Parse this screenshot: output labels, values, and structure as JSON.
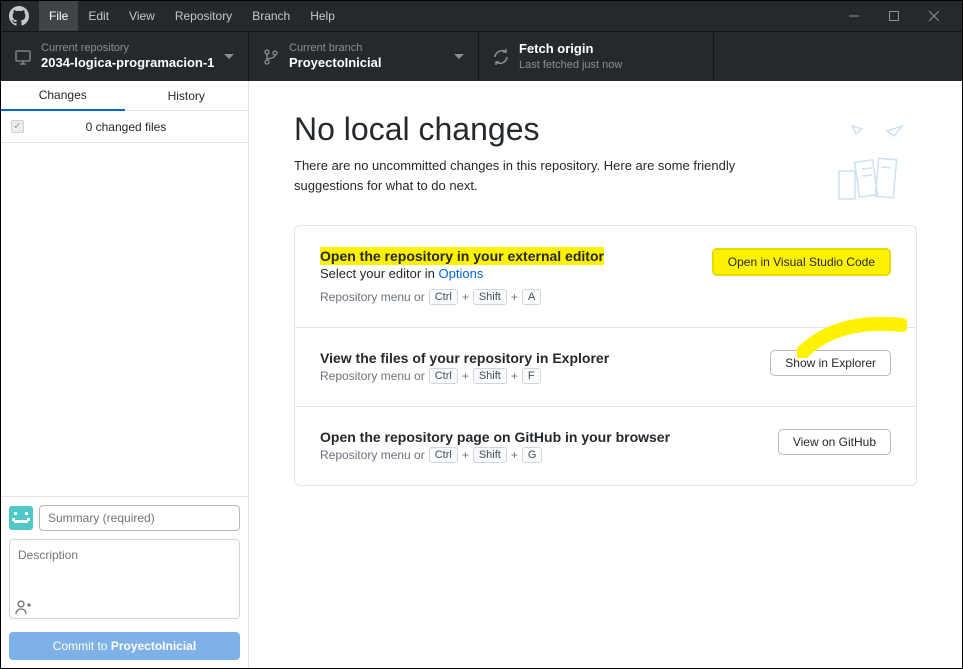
{
  "menubar": {
    "items": [
      "File",
      "Edit",
      "View",
      "Repository",
      "Branch",
      "Help"
    ],
    "active_index": 0
  },
  "toolbar": {
    "repo": {
      "label": "Current repository",
      "value": "2034-logica-programacion-1"
    },
    "branch": {
      "label": "Current branch",
      "value": "ProyectoInicial"
    },
    "fetch": {
      "label": "Fetch origin",
      "value": "Last fetched just now"
    }
  },
  "sidebar": {
    "tabs": {
      "changes": "Changes",
      "history": "History",
      "active": "changes"
    },
    "changed_files": "0 changed files",
    "summary_placeholder": "Summary (required)",
    "description_placeholder": "Description",
    "commit_prefix": "Commit to ",
    "commit_branch": "ProyectoInicial"
  },
  "content": {
    "title": "No local changes",
    "subtitle": "There are no uncommitted changes in this repository. Here are some friendly suggestions for what to do next.",
    "cards": [
      {
        "title": "Open the repository in your external editor",
        "sub_prefix": "Select your editor in ",
        "sub_link": "Options",
        "hint_prefix": "Repository menu or",
        "keys": [
          "Ctrl",
          "Shift",
          "A"
        ],
        "button": "Open in Visual Studio Code",
        "highlighted": true
      },
      {
        "title": "View the files of your repository in Explorer",
        "hint_prefix": "Repository menu or",
        "keys": [
          "Ctrl",
          "Shift",
          "F"
        ],
        "button": "Show in Explorer"
      },
      {
        "title": "Open the repository page on GitHub in your browser",
        "hint_prefix": "Repository menu or",
        "keys": [
          "Ctrl",
          "Shift",
          "G"
        ],
        "button": "View on GitHub"
      }
    ]
  }
}
